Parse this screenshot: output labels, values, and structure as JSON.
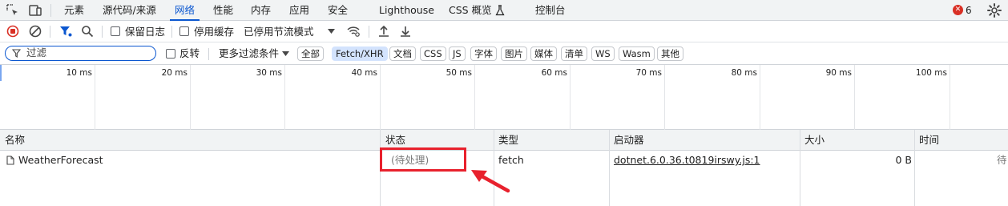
{
  "tabs": [
    {
      "label": "元素",
      "active": false
    },
    {
      "label": "源代码/来源",
      "active": false
    },
    {
      "label": "网络",
      "active": true
    },
    {
      "label": "性能",
      "active": false
    },
    {
      "label": "内存",
      "active": false
    },
    {
      "label": "应用",
      "active": false
    },
    {
      "label": "安全",
      "active": false
    },
    {
      "label": "Lighthouse",
      "active": false
    },
    {
      "label": "CSS 概览",
      "active": false
    },
    {
      "label": "控制台",
      "active": false
    }
  ],
  "error_count": "6",
  "error_badge_glyph": "✕",
  "toolbar": {
    "preserve_log_label": "保留日志",
    "disable_cache_label": "停用缓存",
    "throttle_label": "已停用节流模式"
  },
  "filter": {
    "placeholder": "过滤",
    "invert_label": "反转",
    "more_filters_label": "更多过滤条件",
    "types": [
      {
        "label": "全部",
        "selected": false
      },
      {
        "label": "Fetch/XHR",
        "selected": true
      },
      {
        "label": "文档",
        "selected": false
      },
      {
        "label": "CSS",
        "selected": false
      },
      {
        "label": "JS",
        "selected": false
      },
      {
        "label": "字体",
        "selected": false
      },
      {
        "label": "图片",
        "selected": false
      },
      {
        "label": "媒体",
        "selected": false
      },
      {
        "label": "清单",
        "selected": false
      },
      {
        "label": "WS",
        "selected": false
      },
      {
        "label": "Wasm",
        "selected": false
      },
      {
        "label": "其他",
        "selected": false
      }
    ]
  },
  "timeline_ticks": [
    "10 ms",
    "20 ms",
    "30 ms",
    "40 ms",
    "50 ms",
    "60 ms",
    "70 ms",
    "80 ms",
    "90 ms",
    "100 ms"
  ],
  "columns": {
    "name": "名称",
    "status": "状态",
    "type": "类型",
    "initiator": "启动器",
    "size": "大小",
    "time": "时间"
  },
  "rows": [
    {
      "name": "WeatherForecast",
      "status": "(待处理)",
      "type": "fetch",
      "initiator": "dotnet.6.0.36.t0819irswy.js:1",
      "size": "0 B",
      "time": "待"
    }
  ],
  "colors": {
    "accent": "#0b57d0",
    "annotation": "#e8212d",
    "error": "#d93025"
  }
}
